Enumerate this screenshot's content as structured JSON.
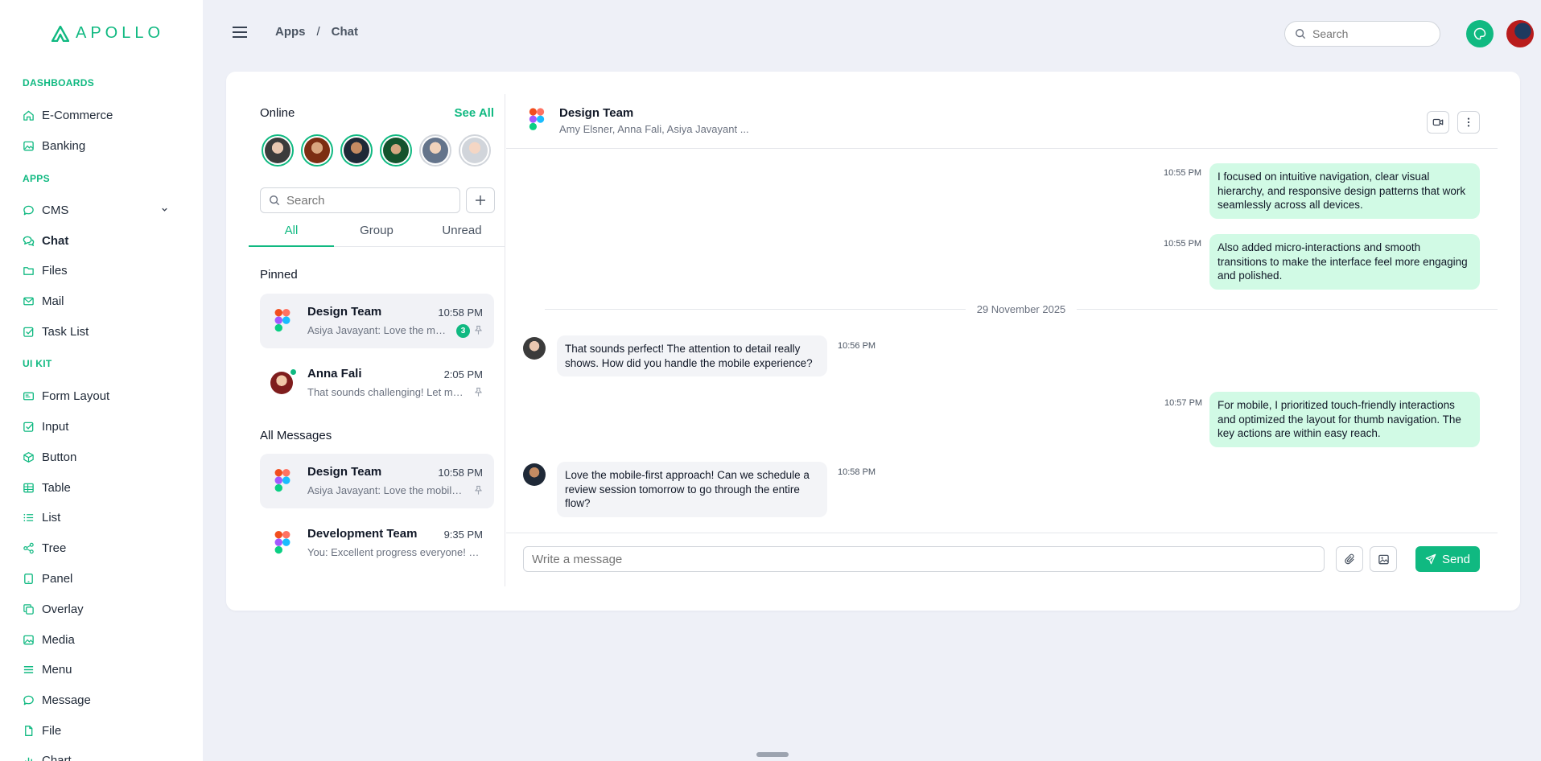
{
  "brand": {
    "name": "APOLLO",
    "color": "#10b981"
  },
  "sidebar": {
    "sections": [
      {
        "title": "DASHBOARDS",
        "items": [
          {
            "label": "E-Commerce",
            "icon": "home-icon"
          },
          {
            "label": "Banking",
            "icon": "image-icon"
          }
        ]
      },
      {
        "title": "APPS",
        "items": [
          {
            "label": "CMS",
            "icon": "chat-bubble-icon"
          },
          {
            "label": "Chat",
            "icon": "chat-bubbles-icon"
          },
          {
            "label": "Files",
            "icon": "folder-icon"
          },
          {
            "label": "Mail",
            "icon": "mail-icon"
          },
          {
            "label": "Task List",
            "icon": "checkbox-icon"
          }
        ]
      },
      {
        "title": "UI KIT",
        "items": [
          {
            "label": "Form Layout",
            "icon": "id-card-icon"
          },
          {
            "label": "Input",
            "icon": "checkbox-icon"
          },
          {
            "label": "Button",
            "icon": "box-icon"
          },
          {
            "label": "Table",
            "icon": "table-icon"
          },
          {
            "label": "List",
            "icon": "list-icon"
          },
          {
            "label": "Tree",
            "icon": "share-icon"
          },
          {
            "label": "Panel",
            "icon": "tablet-icon"
          },
          {
            "label": "Overlay",
            "icon": "copy-icon"
          },
          {
            "label": "Media",
            "icon": "image-icon"
          },
          {
            "label": "Menu",
            "icon": "menu-icon"
          },
          {
            "label": "Message",
            "icon": "chat-bubble-icon"
          },
          {
            "label": "File",
            "icon": "file-icon"
          },
          {
            "label": "Chart",
            "icon": "chart-icon"
          }
        ]
      }
    ],
    "active": "Chat"
  },
  "topbar": {
    "breadcrumb": [
      "Apps",
      "Chat"
    ],
    "search_placeholder": "Search"
  },
  "chatlist": {
    "online_title": "Online",
    "see_all": "See All",
    "search_placeholder": "Search",
    "tabs": [
      "All",
      "Group",
      "Unread"
    ],
    "active_tab": "All",
    "pinned_title": "Pinned",
    "all_title": "All Messages",
    "pinned": [
      {
        "name": "Design Team",
        "time": "10:58 PM",
        "preview": "Asiya Javayant: Love the mobile-first approach!",
        "badge": "3"
      },
      {
        "name": "Anna Fali",
        "time": "2:05 PM",
        "preview": "That sounds challenging! Let me know if you need help",
        "badge": ""
      }
    ],
    "all": [
      {
        "name": "Design Team",
        "time": "10:58 PM",
        "preview": "Asiya Javayant: Love the mobile-first approach!"
      },
      {
        "name": "Development Team",
        "time": "9:35 PM",
        "preview": "You: Excellent progress everyone! Keep it up"
      }
    ]
  },
  "chat": {
    "name": "Design Team",
    "members": "Amy Elsner, Anna Fali, Asiya Javayant ...",
    "date_separator": "29 November 2025",
    "messages": [
      {
        "dir": "out",
        "time": "10:55 PM",
        "text": "I focused on intuitive navigation, clear visual hierarchy, and responsive design patterns that work seamlessly across all devices."
      },
      {
        "dir": "out",
        "time": "10:55 PM",
        "text": "Also added micro-interactions and smooth transitions to make the interface feel more engaging and polished."
      },
      {
        "dir": "in",
        "time": "10:56 PM",
        "text": "That sounds perfect! The attention to detail really shows. How did you handle the mobile experience?"
      },
      {
        "dir": "out",
        "time": "10:57 PM",
        "text": "For mobile, I prioritized touch-friendly interactions and optimized the layout for thumb navigation. The key actions are within easy reach."
      },
      {
        "dir": "in",
        "time": "10:58 PM",
        "text": "Love the mobile-first approach! Can we schedule a review session tomorrow to go through the entire flow?"
      }
    ],
    "input_placeholder": "Write a message",
    "send_label": "Send"
  }
}
